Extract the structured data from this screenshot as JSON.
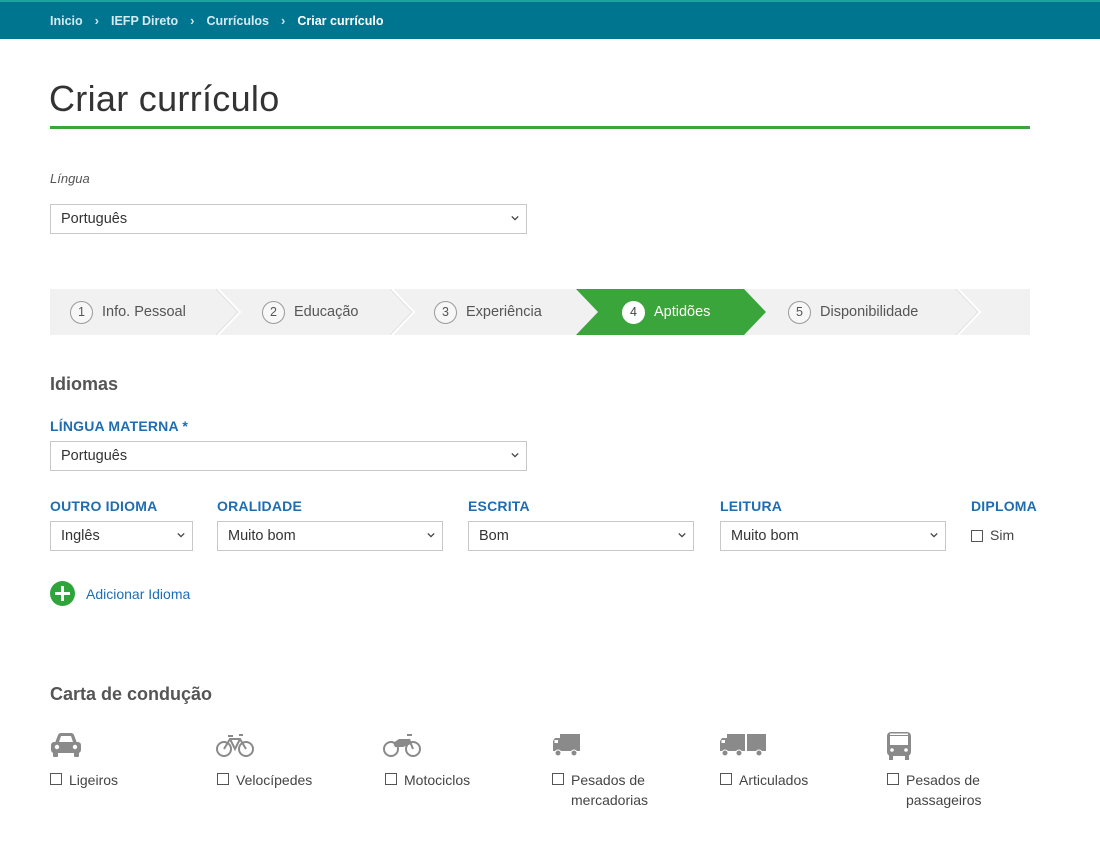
{
  "breadcrumb": {
    "items": [
      "Inicio",
      "IEFP Direto",
      "Currículos"
    ],
    "current": "Criar currículo"
  },
  "page": {
    "title": "Criar currículo"
  },
  "language_select": {
    "label": "Língua",
    "value": "Português"
  },
  "steps": [
    {
      "num": "1",
      "label": "Info. Pessoal"
    },
    {
      "num": "2",
      "label": "Educação"
    },
    {
      "num": "3",
      "label": "Experiência"
    },
    {
      "num": "4",
      "label": "Aptidões",
      "active": true
    },
    {
      "num": "5",
      "label": "Disponibilidade"
    }
  ],
  "idiomas": {
    "title": "Idiomas",
    "mother_tongue_label": "LÍNGUA MATERNA *",
    "mother_tongue_value": "Português",
    "columns": {
      "other": "OUTRO IDIOMA",
      "oral": "ORALIDADE",
      "written": "ESCRITA",
      "reading": "LEITURA",
      "diploma": "DIPLOMA"
    },
    "row": {
      "other": "Inglês",
      "oral": "Muito bom",
      "written": "Bom",
      "reading": "Muito bom",
      "diploma_label": "Sim"
    },
    "add_label": "Adicionar Idioma"
  },
  "driving": {
    "title": "Carta de condução",
    "categories": [
      {
        "icon": "car-icon",
        "label": "Ligeiros"
      },
      {
        "icon": "bicycle-icon",
        "label": "Velocípedes"
      },
      {
        "icon": "motorcycle-icon",
        "label": "Motociclos"
      },
      {
        "icon": "truck-icon",
        "label": "Pesados de mercadorias"
      },
      {
        "icon": "articulated-truck-icon",
        "label": "Articulados"
      },
      {
        "icon": "bus-icon",
        "label": "Pesados de passageiros"
      }
    ]
  },
  "colors": {
    "topbar": "#00758f",
    "accent_green": "#3aa53a",
    "link_blue": "#1e6db3"
  }
}
